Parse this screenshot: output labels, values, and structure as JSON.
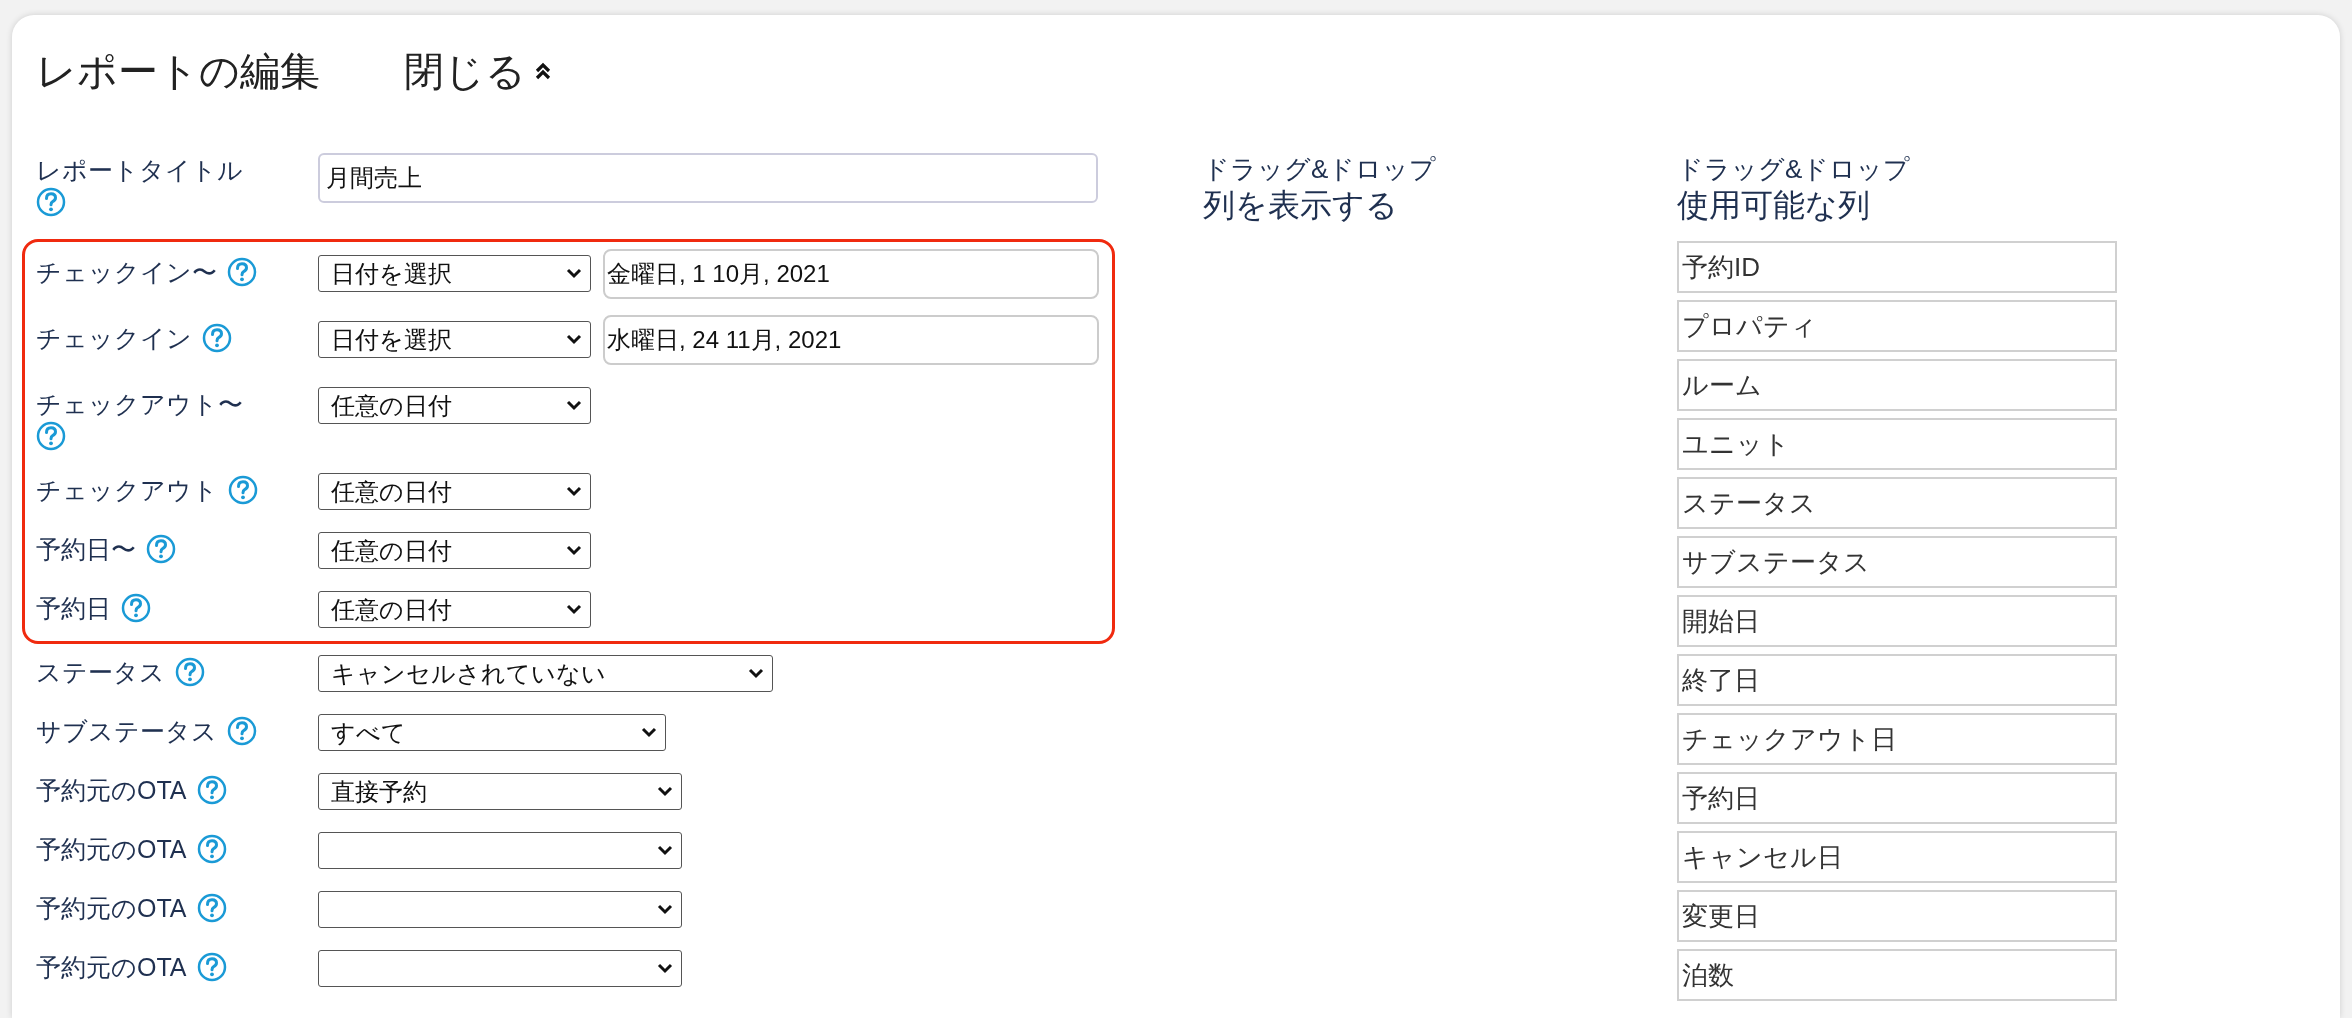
{
  "header": {
    "title": "レポートの編集",
    "toggle": {
      "label": "閉じる",
      "expanded": true
    }
  },
  "report_title": {
    "label": "レポートタイトル",
    "value": "月間売上"
  },
  "filters": [
    {
      "label": "チェックイン〜",
      "select": "日付を選択",
      "date": "金曜日, 1 10月, 2021",
      "highlighted": true
    },
    {
      "label": "チェックイン",
      "select": "日付を選択",
      "date": "水曜日, 24 11月, 2021",
      "highlighted": true
    },
    {
      "label": "チェックアウト〜",
      "select": "任意の日付",
      "highlighted": true
    },
    {
      "label": "チェックアウト",
      "select": "任意の日付",
      "highlighted": true
    },
    {
      "label": "予約日〜",
      "select": "任意の日付",
      "highlighted": true
    },
    {
      "label": "予約日",
      "select": "任意の日付",
      "highlighted": true
    },
    {
      "label": "ステータス",
      "select": "キャンセルされていない",
      "highlighted": false
    },
    {
      "label": "サブステータス",
      "select": "すべて",
      "highlighted": false
    },
    {
      "label": "予約元のOTA",
      "select": "直接予約",
      "highlighted": false
    },
    {
      "label": "予約元のOTA",
      "highlighted": false
    },
    {
      "label": "予約元のOTA",
      "highlighted": false
    },
    {
      "label": "予約元のOTA",
      "highlighted": false
    }
  ],
  "shown_columns": {
    "hint": "ドラッグ&ドロップ",
    "title": "列を表示する"
  },
  "available_columns": {
    "hint": "ドラッグ&ドロップ",
    "title": "使用可能な列",
    "items": [
      "予約ID",
      "プロパティ",
      "ルーム",
      "ユニット",
      "ステータス",
      "サブステータス",
      "開始日",
      "終了日",
      "チェックアウト日",
      "予約日",
      "キャンセル日",
      "変更日",
      "泊数"
    ]
  }
}
